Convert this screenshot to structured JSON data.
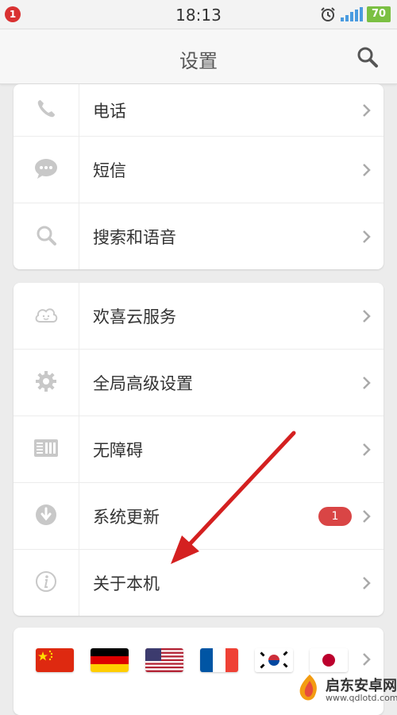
{
  "status_bar": {
    "notification_count": "1",
    "time": "18:13",
    "battery": "70",
    "icons": [
      "alarm-icon",
      "signal-icon",
      "battery-icon"
    ]
  },
  "header": {
    "title": "设置",
    "search_icon": "search-icon"
  },
  "group1": [
    {
      "label": "电话",
      "icon": "phone-icon"
    },
    {
      "label": "短信",
      "icon": "message-icon"
    },
    {
      "label": "搜索和语音",
      "icon": "search-icon"
    }
  ],
  "group2": [
    {
      "label": "欢喜云服务",
      "icon": "cloud-icon"
    },
    {
      "label": "全局高级设置",
      "icon": "gear-icon"
    },
    {
      "label": "无障碍",
      "icon": "accessibility-icon"
    },
    {
      "label": "系统更新",
      "icon": "download-icon",
      "badge": "1"
    },
    {
      "label": "关于本机",
      "icon": "info-icon"
    }
  ],
  "languages": [
    "china-flag",
    "germany-flag",
    "usa-flag",
    "france-flag",
    "korea-flag",
    "japan-flag"
  ],
  "watermark": {
    "name": "启东安卓网",
    "url": "www.qdlotd.com"
  },
  "colors": {
    "accent_red": "#d94545",
    "battery_green": "#7bc043",
    "annotation_arrow": "#d42020"
  }
}
